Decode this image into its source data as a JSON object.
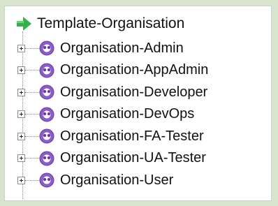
{
  "tree": {
    "root": {
      "label": "Template-Organisation",
      "icon": "green-arrow-icon"
    },
    "items": [
      {
        "label": "Organisation-Admin",
        "icon": "role-group-icon",
        "expanded": false
      },
      {
        "label": "Organisation-AppAdmin",
        "icon": "role-group-icon",
        "expanded": false
      },
      {
        "label": "Organisation-Developer",
        "icon": "role-group-icon",
        "expanded": false
      },
      {
        "label": "Organisation-DevOps",
        "icon": "role-group-icon",
        "expanded": false
      },
      {
        "label": "Organisation-FA-Tester",
        "icon": "role-group-icon",
        "expanded": false
      },
      {
        "label": "Organisation-UA-Tester",
        "icon": "role-group-icon",
        "expanded": false
      },
      {
        "label": "Organisation-User",
        "icon": "role-group-icon",
        "expanded": false
      }
    ]
  },
  "colors": {
    "root_arrow": "#2fb34a",
    "role_icon_fill": "#8a5cc7",
    "role_icon_ring": "#6b3aa8",
    "background": "#d9e4cf"
  }
}
